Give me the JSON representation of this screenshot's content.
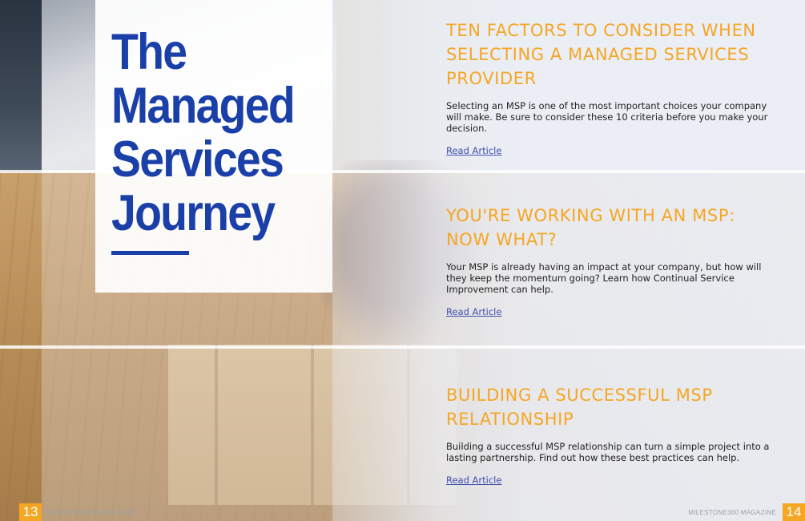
{
  "feature": {
    "title": "The\nManaged\nServices\nJourney"
  },
  "articles": [
    {
      "heading": "Ten Factors to Consider when Selecting a Managed Services Provider",
      "body": "Selecting an MSP is one of the most important choices your company will make. Be sure to consider these 10 criteria before you make your decision.",
      "link": "Read Article"
    },
    {
      "heading": "You're Working with an MSP: Now What?",
      "body": "Your MSP is already having an impact at your company, but how will they keep the momentum going? Learn how Continual Service Improvement can help.",
      "link": "Read Article"
    },
    {
      "heading": "Building a Successful MSP Relationship",
      "body": "Building a successful MSP relationship can turn a simple project into a lasting partnership. Find out how these best practices can help.",
      "link": "Read Article"
    }
  ],
  "footer": {
    "left_page": "13",
    "left_publication": "MILESTONE360 MAGAZINE",
    "right_publication": "MILESTONE360 MAGAZINE",
    "right_page": "14"
  },
  "colors": {
    "title_blue": "#1a3fa8",
    "heading_orange": "#f5a623",
    "link_blue": "#3f4fae"
  }
}
